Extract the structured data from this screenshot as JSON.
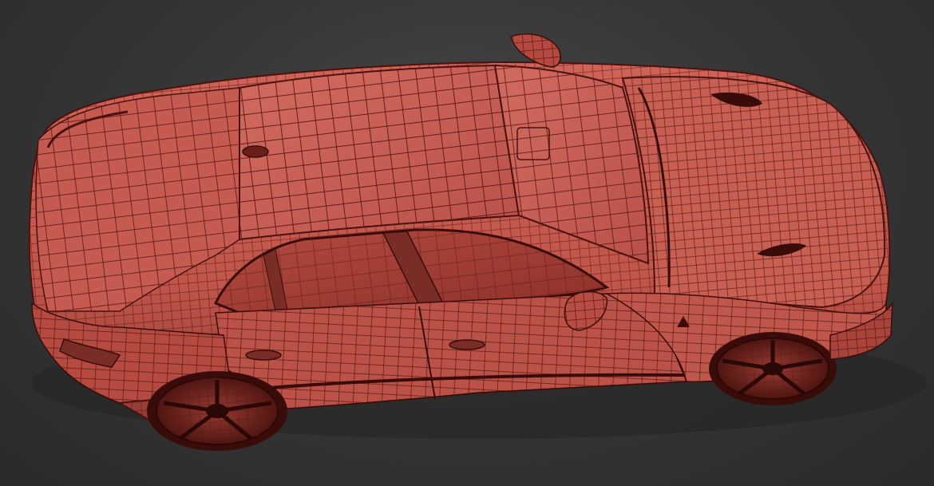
{
  "scene": {
    "subject": "car-wireframe-render",
    "colors": {
      "background": "#3a3a3a",
      "body": "#c85a50",
      "body_dark": "#7a2c26",
      "wire": "#5a1612",
      "shadow": "#1c1c1c"
    }
  }
}
